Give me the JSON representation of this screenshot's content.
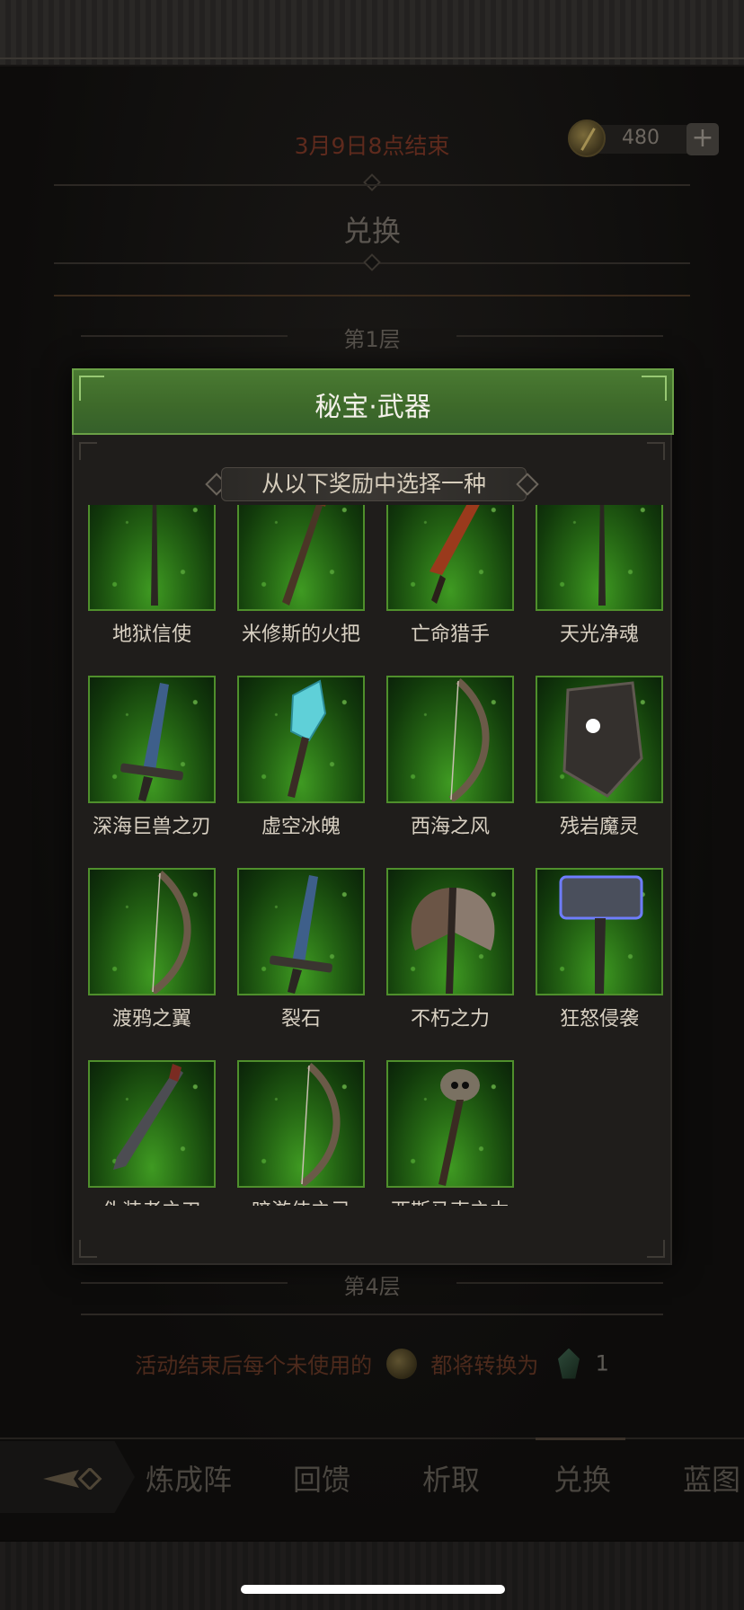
{
  "header": {
    "end_time": "3月9日8点结束",
    "currency_amount": "480",
    "add_label": "+",
    "page_title": "兑换"
  },
  "floors": {
    "first": "第1层",
    "fourth": "第4层"
  },
  "conversion_note": {
    "prefix": "活动结束后每个未使用的",
    "middle": "都将转换为",
    "amount": "1"
  },
  "bottom_nav": {
    "items": [
      {
        "label": "炼成阵"
      },
      {
        "label": "回馈"
      },
      {
        "label": "析取"
      },
      {
        "label": "兑换"
      },
      {
        "label": "蓝图"
      }
    ],
    "active": "兑换"
  },
  "modal": {
    "title": "秘宝·武器",
    "subtitle": "从以下奖励中选择一种",
    "weapons": [
      {
        "name": "地狱信使",
        "icon": "staff-icon"
      },
      {
        "name": "米修斯的火把",
        "icon": "torch-icon"
      },
      {
        "name": "亡命猎手",
        "icon": "blade-icon"
      },
      {
        "name": "天光净魂",
        "icon": "staff-icon"
      },
      {
        "name": "深海巨兽之刃",
        "icon": "greatsword-icon"
      },
      {
        "name": "虚空冰魄",
        "icon": "ice-scepter-icon"
      },
      {
        "name": "西海之风",
        "icon": "bow-icon"
      },
      {
        "name": "残岩魔灵",
        "icon": "shield-icon"
      },
      {
        "name": "渡鸦之翼",
        "icon": "bow-icon"
      },
      {
        "name": "裂石",
        "icon": "greatsword-icon"
      },
      {
        "name": "不朽之力",
        "icon": "axe-icon"
      },
      {
        "name": "狂怒侵袭",
        "icon": "hammer-icon"
      },
      {
        "name": "伪装者之刃",
        "icon": "dagger-icon"
      },
      {
        "name": "暗游侠之弓",
        "icon": "bow-icon"
      },
      {
        "name": "西斯马克之力",
        "icon": "skull-staff-icon"
      }
    ]
  }
}
